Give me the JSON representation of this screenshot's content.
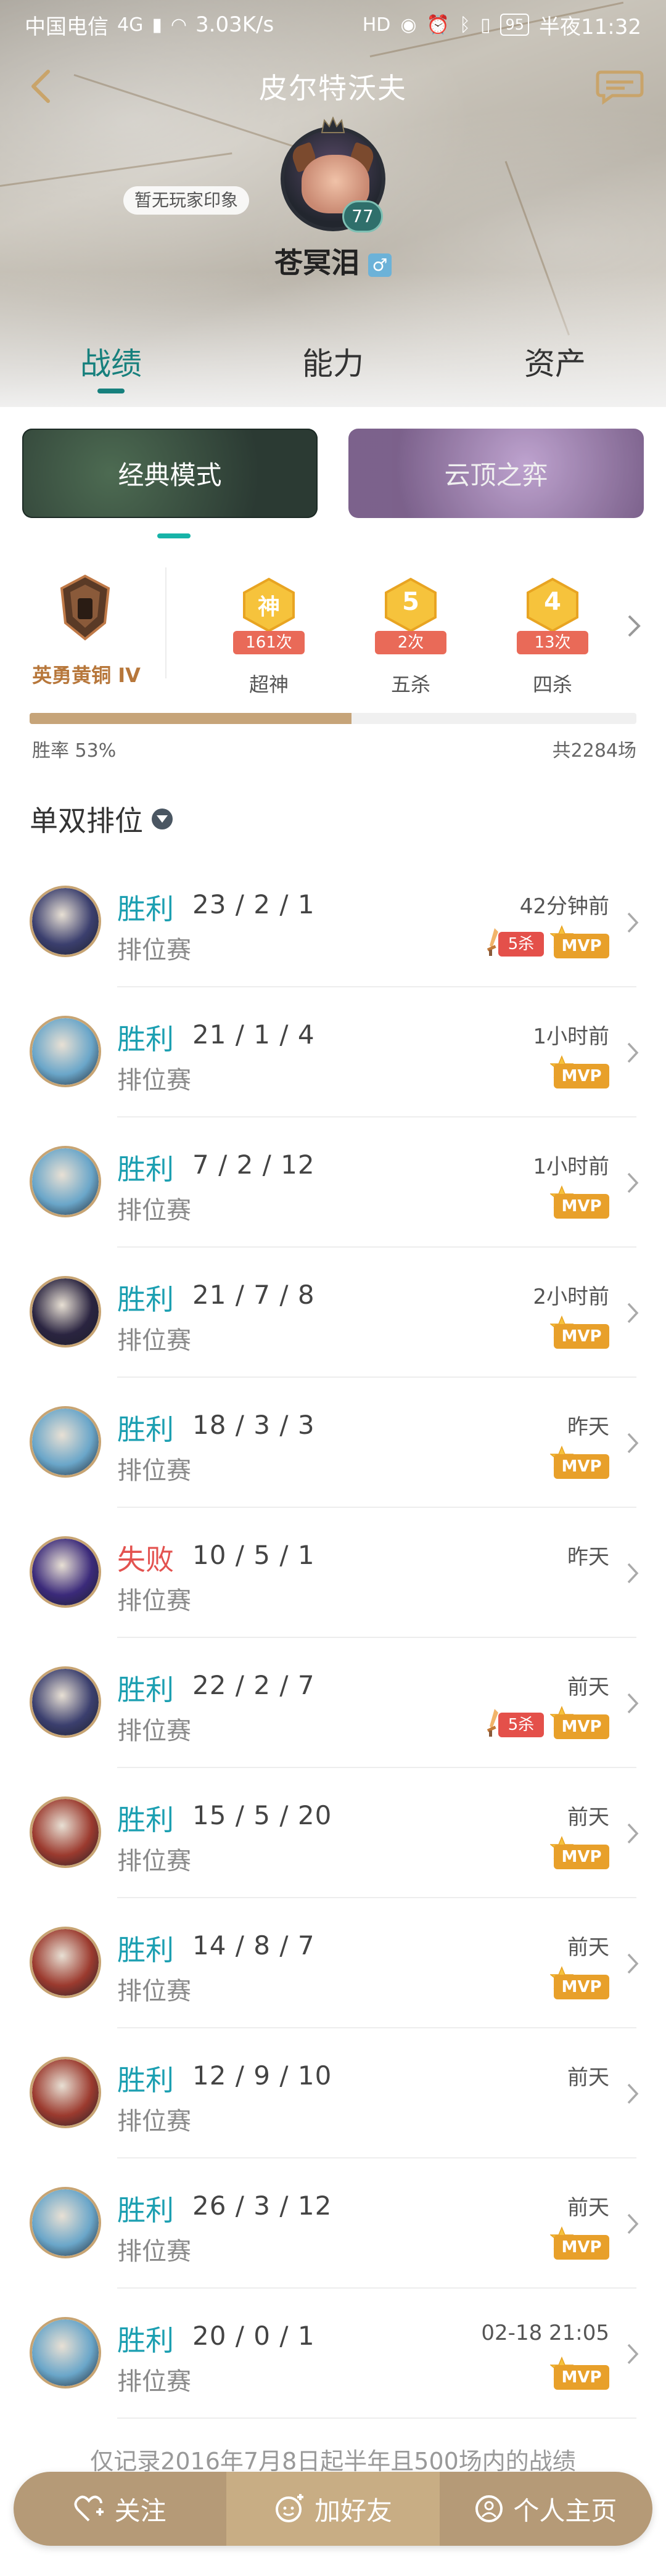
{
  "status_bar": {
    "carrier": "中国电信",
    "network": "4G",
    "speed": "3.03K/s",
    "battery": "95",
    "time": "半夜11:32"
  },
  "nav": {
    "title": "皮尔特沃夫"
  },
  "profile": {
    "impression_tag": "暂无玩家印象",
    "level": "77",
    "name": "苍冥泪",
    "gender_symbol": "♂"
  },
  "tabs": [
    {
      "label": "战绩",
      "active": true
    },
    {
      "label": "能力",
      "active": false
    },
    {
      "label": "资产",
      "active": false
    }
  ],
  "modes": {
    "classic": "经典模式",
    "tft": "云顶之弈"
  },
  "stats": {
    "rank_name": "英勇黄铜 IV",
    "achievements": [
      {
        "glyph": "神",
        "count": "161次",
        "label": "超神"
      },
      {
        "glyph": "5",
        "count": "2次",
        "label": "五杀"
      },
      {
        "glyph": "4",
        "count": "13次",
        "label": "四杀"
      }
    ],
    "win_rate_text": "胜率  53%",
    "win_rate_value": 0.53,
    "total_games": "共2284场"
  },
  "queue": {
    "title": "单双排位"
  },
  "matches": [
    {
      "result": "胜利",
      "outcome": "win",
      "kda": "23 / 2 / 1",
      "mode": "排位赛",
      "time": "42分钟前",
      "penta": "5杀",
      "mvp": "MVP",
      "champ_color": "#3b3f6e"
    },
    {
      "result": "胜利",
      "outcome": "win",
      "kda": "21 / 1 / 4",
      "mode": "排位赛",
      "time": "1小时前",
      "penta": "",
      "mvp": "MVP",
      "champ_color": "#6aa6c9"
    },
    {
      "result": "胜利",
      "outcome": "win",
      "kda": "7 / 2 / 12",
      "mode": "排位赛",
      "time": "1小时前",
      "penta": "",
      "mvp": "MVP",
      "champ_color": "#6aa6c9"
    },
    {
      "result": "胜利",
      "outcome": "win",
      "kda": "21 / 7 / 8",
      "mode": "排位赛",
      "time": "2小时前",
      "penta": "",
      "mvp": "MVP",
      "champ_color": "#2a2440"
    },
    {
      "result": "胜利",
      "outcome": "win",
      "kda": "18 / 3 / 3",
      "mode": "排位赛",
      "time": "昨天",
      "penta": "",
      "mvp": "MVP",
      "champ_color": "#6aa6c9"
    },
    {
      "result": "失败",
      "outcome": "loss",
      "kda": "10 / 5 / 1",
      "mode": "排位赛",
      "time": "昨天",
      "penta": "",
      "mvp": "",
      "champ_color": "#3b2a7a"
    },
    {
      "result": "胜利",
      "outcome": "win",
      "kda": "22 / 2 / 7",
      "mode": "排位赛",
      "time": "前天",
      "penta": "5杀",
      "mvp": "MVP",
      "champ_color": "#3b3f6e"
    },
    {
      "result": "胜利",
      "outcome": "win",
      "kda": "15 / 5 / 20",
      "mode": "排位赛",
      "time": "前天",
      "penta": "",
      "mvp": "MVP",
      "champ_color": "#9b3a2e"
    },
    {
      "result": "胜利",
      "outcome": "win",
      "kda": "14 / 8 / 7",
      "mode": "排位赛",
      "time": "前天",
      "penta": "",
      "mvp": "MVP",
      "champ_color": "#9b3a2e"
    },
    {
      "result": "胜利",
      "outcome": "win",
      "kda": "12 / 9 / 10",
      "mode": "排位赛",
      "time": "前天",
      "penta": "",
      "mvp": "",
      "champ_color": "#9b3a2e"
    },
    {
      "result": "胜利",
      "outcome": "win",
      "kda": "26 / 3 / 12",
      "mode": "排位赛",
      "time": "前天",
      "penta": "",
      "mvp": "MVP",
      "champ_color": "#6aa6c9"
    },
    {
      "result": "胜利",
      "outcome": "win",
      "kda": "20 / 0 / 1",
      "mode": "排位赛",
      "time": "02-18 21:05",
      "penta": "",
      "mvp": "MVP",
      "champ_color": "#6aa6c9"
    }
  ],
  "footnote": "仅记录2016年7月8日起半年且500场内的战绩",
  "actions": {
    "follow": "关注",
    "add_friend": "加好友",
    "home": "个人主页"
  },
  "colors": {
    "accent": "#17807d",
    "win": "#1c9fb1",
    "loss": "#e3524f",
    "mvp": "#e8a02a",
    "penta": "#e4504a",
    "gold": "#c6a479"
  }
}
